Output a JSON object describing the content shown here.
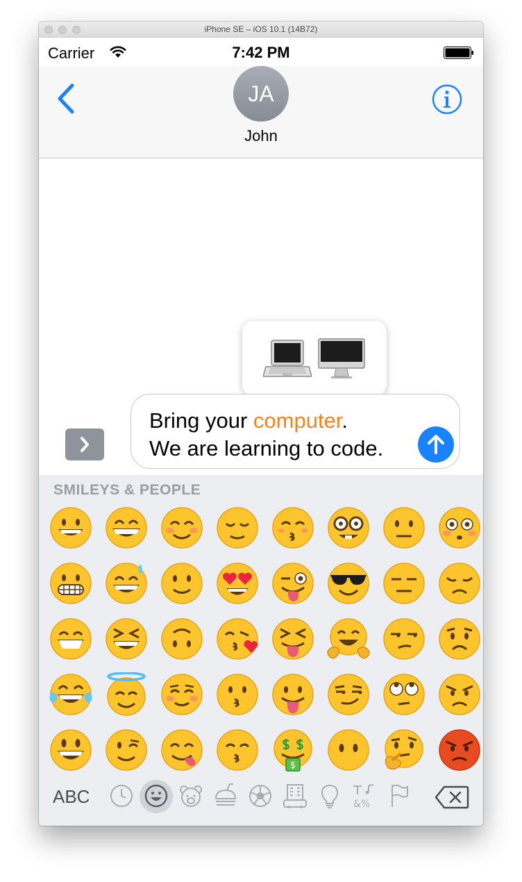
{
  "window": {
    "title": "iPhone SE – iOS 10.1 (14B72)"
  },
  "status_bar": {
    "carrier": "Carrier",
    "time": "7:42 PM"
  },
  "nav": {
    "avatar_initials": "JA",
    "contact_name": "John"
  },
  "suggestions": {
    "items": [
      "laptop-computer",
      "desktop-computer"
    ]
  },
  "composer": {
    "line1_before": "Bring your ",
    "line1_highlight": "computer",
    "line1_after": ".",
    "line2": "We are learning to code."
  },
  "keyboard": {
    "section_title": "SMILEYS & PEOPLE",
    "abc_label": "ABC",
    "emoji_grid": [
      [
        "grinning",
        "grin-squint-eyes",
        "blush",
        "relieved",
        "kissing-closed-eyes",
        "nerd",
        "neutral",
        "flushed"
      ],
      [
        "grimacing",
        "sweat-smile",
        "slight-smile",
        "heart-eyes",
        "wink-tongue",
        "sunglasses",
        "expressionless",
        "disappointed"
      ],
      [
        "grin",
        "laughing",
        "upside-down",
        "kissing-heart",
        "squint-tongue",
        "hugging",
        "unamused",
        "worried"
      ],
      [
        "joy",
        "innocent",
        "relaxed",
        "kissing",
        "tongue",
        "smirk",
        "eye-roll",
        "angry"
      ],
      [
        "smiley",
        "wink",
        "yum",
        "kissing-smiling-eyes",
        "money-mouth",
        "no-mouth",
        "thinking",
        "rage"
      ]
    ],
    "categories": [
      "recent",
      "smileys",
      "animals",
      "food",
      "activity",
      "travel",
      "objects",
      "symbols",
      "flags"
    ],
    "selected_category": "smileys"
  },
  "colors": {
    "accent": "#1a82fb",
    "highlight": "#f6821f",
    "emoji_yellow": "#fcc42d",
    "rage_red": "#e84b1f"
  }
}
